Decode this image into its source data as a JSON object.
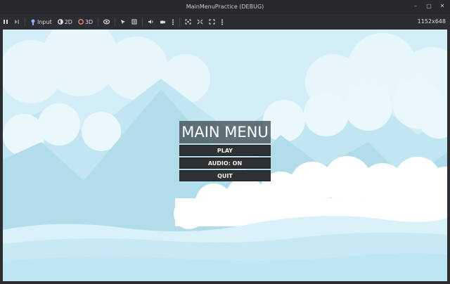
{
  "window": {
    "title": "MainMenuPractice (DEBUG)",
    "controls": [
      "–",
      "▢",
      "✕"
    ]
  },
  "toolbar": {
    "input_label": "Input",
    "mode_2d_label": "2D",
    "mode_3d_label": "3D",
    "resolution": "1152x648",
    "icons": [
      "pause-icon",
      "step-icon",
      "input-icon",
      "2d-icon",
      "3d-icon",
      "eye-icon",
      "select-icon",
      "list-icon",
      "speaker-icon",
      "camera-icon",
      "more-icon",
      "focus-icon",
      "fit-icon",
      "expand-icon",
      "more-icon"
    ]
  },
  "menu": {
    "title": "MAIN MENU",
    "play_label": "PLAY",
    "audio_label": "AUDIO: ON",
    "quit_label": "QUIT"
  },
  "colors": {
    "sky": "#d3eef6",
    "mountain_far": "#b9e1ee",
    "mountain_near": "#a9d9e8",
    "cloud": "#ffffff",
    "button_bg": "#2e3134",
    "title_bg": "#374248"
  }
}
